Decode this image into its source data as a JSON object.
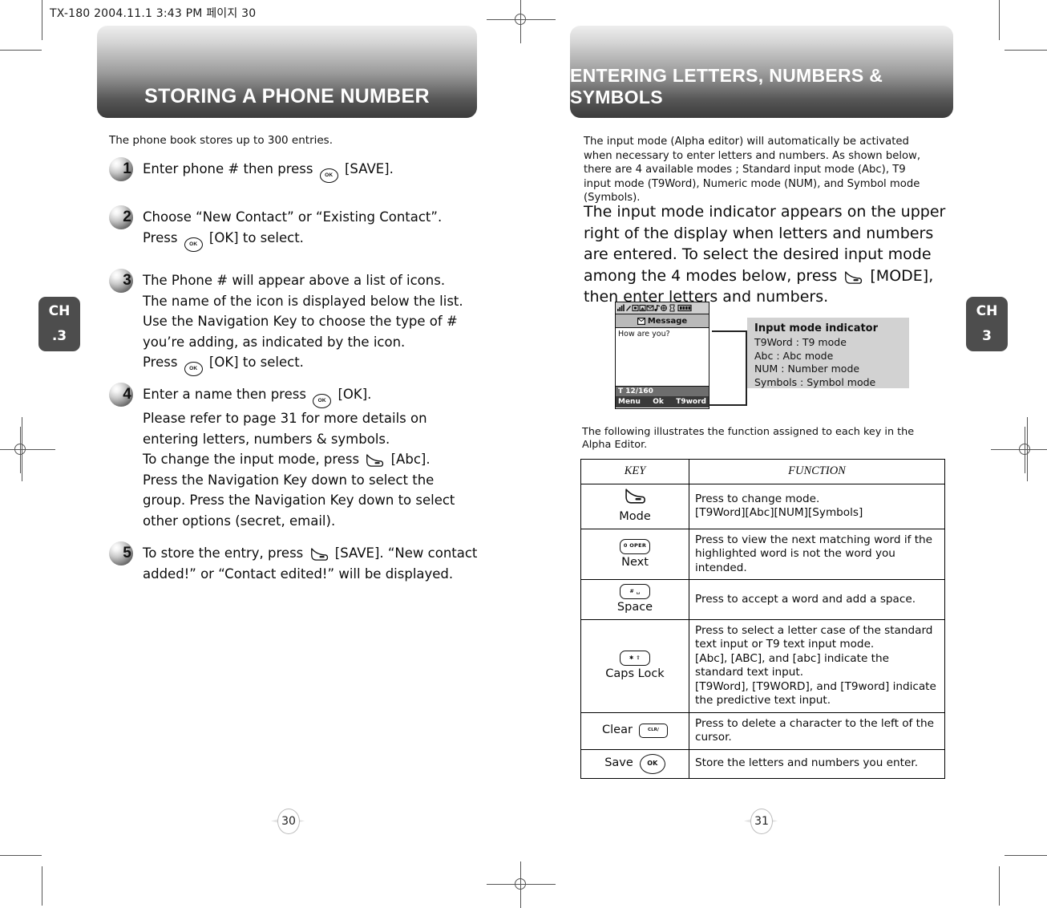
{
  "print_slug": "TX-180  2004.11.1 3:43 PM 페이지 30",
  "chapter_tab_left": {
    "line1": "CH",
    "line2": ".3"
  },
  "chapter_tab_right": {
    "line1": "CH",
    "line2": "3"
  },
  "left_page": {
    "banner_title": "STORING A PHONE NUMBER",
    "intro": "The phone book stores up to 300 entries.",
    "page_number": "30",
    "steps": [
      {
        "number": "1",
        "lines": [
          {
            "parts": [
              {
                "t": "text",
                "v": "Enter phone # then press "
              },
              {
                "t": "key",
                "v": "ok"
              },
              {
                "t": "text",
                "v": " [SAVE]."
              }
            ]
          }
        ]
      },
      {
        "number": "2",
        "lines": [
          {
            "parts": [
              {
                "t": "text",
                "v": "Choose “New Contact” or “Existing Contact”."
              }
            ]
          },
          {
            "parts": [
              {
                "t": "text",
                "v": "Press "
              },
              {
                "t": "key",
                "v": "ok"
              },
              {
                "t": "text",
                "v": " [OK] to select."
              }
            ]
          }
        ]
      },
      {
        "number": "3",
        "lines": [
          {
            "parts": [
              {
                "t": "text",
                "v": "The Phone # will appear above a list of icons."
              }
            ]
          },
          {
            "parts": [
              {
                "t": "text",
                "v": "The name of the icon is displayed below the list."
              }
            ]
          },
          {
            "parts": [
              {
                "t": "text",
                "v": "Use the Navigation Key to choose the type of #"
              }
            ]
          },
          {
            "parts": [
              {
                "t": "text",
                "v": "you’re adding, as indicated by the icon."
              }
            ]
          },
          {
            "parts": [
              {
                "t": "text",
                "v": "Press "
              },
              {
                "t": "key",
                "v": "ok"
              },
              {
                "t": "text",
                "v": " [OK] to select."
              }
            ]
          }
        ]
      },
      {
        "number": "4",
        "lines": [
          {
            "parts": [
              {
                "t": "text",
                "v": "Enter a name then press "
              },
              {
                "t": "key",
                "v": "ok"
              },
              {
                "t": "text",
                "v": " [OK]."
              }
            ]
          },
          {
            "parts": [
              {
                "t": "text",
                "v": "Please refer to page 31 for more details on"
              }
            ]
          },
          {
            "parts": [
              {
                "t": "text",
                "v": "entering letters, numbers & symbols."
              }
            ]
          },
          {
            "parts": [
              {
                "t": "text",
                "v": "To change the input mode, press "
              },
              {
                "t": "key",
                "v": "soft"
              },
              {
                "t": "text",
                "v": " [Abc]."
              }
            ]
          },
          {
            "parts": [
              {
                "t": "text",
                "v": "Press the Navigation Key down to select the"
              }
            ]
          },
          {
            "parts": [
              {
                "t": "text",
                "v": "group. Press the Navigation Key down to select"
              }
            ]
          },
          {
            "parts": [
              {
                "t": "text",
                "v": "other options (secret, email)."
              }
            ]
          }
        ]
      },
      {
        "number": "5",
        "lines": [
          {
            "parts": [
              {
                "t": "text",
                "v": "To store the entry, press "
              },
              {
                "t": "key",
                "v": "soft"
              },
              {
                "t": "text",
                "v": " [SAVE]. “New contact"
              }
            ]
          },
          {
            "parts": [
              {
                "t": "text",
                "v": "added!” or “Contact edited!” will be displayed."
              }
            ]
          }
        ]
      }
    ]
  },
  "right_page": {
    "banner_title": "ENTERING LETTERS, NUMBERS & SYMBOLS",
    "page_number": "31",
    "intro": "The input mode (Alpha editor) will automatically be activated when necessary to enter letters and numbers. As shown below, there are 4 available modes ; Standard input mode (Abc), T9 input mode (T9Word), Numeric mode (NUM), and Symbol mode (Symbols).",
    "lead_parts": [
      {
        "t": "text",
        "v": "The input mode indicator appears on the upper right of the display when letters and numbers are entered. To select the desired input mode among the 4 modes below, press "
      },
      {
        "t": "key",
        "v": "soft"
      },
      {
        "t": "text",
        "v": " [MODE], then enter letters and numbers."
      }
    ],
    "phone_mock": {
      "status_icons": "signal, pen, box, box, envelope, note, globe, alarm, battery",
      "title_icon": "message-icon",
      "title": "Message",
      "body_text": "How are you?",
      "counter": "T 12/160",
      "softkey_left": "Menu",
      "softkey_center": "Ok",
      "softkey_right": "T9word"
    },
    "callout": {
      "heading": "Input mode indicator",
      "items": [
        "T9Word : T9 mode",
        "Abc : Abc mode",
        "NUM : Number mode",
        "Symbols : Symbol mode"
      ]
    },
    "table_note": "The following illustrates the function assigned to each key in the Alpha Editor.",
    "table": {
      "headers": [
        "KEY",
        "FUNCTION"
      ],
      "rows": [
        {
          "key_label": "Mode",
          "key_glyph": "soft-key",
          "key_layout": "stack",
          "function_lines": [
            "Press to change mode.",
            "[T9Word][Abc][NUM][Symbols]"
          ]
        },
        {
          "key_label": "Next",
          "key_glyph": "zero-key",
          "key_glyph_text": "0 OPER",
          "key_layout": "stack",
          "function_lines": [
            "Press to view the next matching word if the highlighted word is not the word you intended."
          ]
        },
        {
          "key_label": "Space",
          "key_glyph": "pound-space-key",
          "key_glyph_text": "# ␣",
          "key_layout": "stack",
          "function_lines": [
            "Press to accept a word and add a space."
          ]
        },
        {
          "key_label": "Caps Lock",
          "key_glyph": "star-shift-key",
          "key_glyph_text": "✱ ⇧",
          "key_layout": "stack",
          "function_lines": [
            "Press to select a letter case of the standard text input or T9 text input mode.",
            "[Abc], [ABC], and [abc] indicate the standard text input.",
            "[T9Word], [T9WORD], and [T9word] indicate the predictive text input."
          ]
        },
        {
          "key_label": "Clear",
          "key_glyph": "clr-key",
          "key_glyph_text": "CLR/ ",
          "key_layout": "row",
          "function_lines": [
            "Press to delete a character to the left of the cursor."
          ]
        },
        {
          "key_label": "Save",
          "key_glyph": "ok-key",
          "key_glyph_text": "OK",
          "key_layout": "row",
          "function_lines": [
            "Store the letters and numbers you enter."
          ]
        }
      ]
    }
  }
}
